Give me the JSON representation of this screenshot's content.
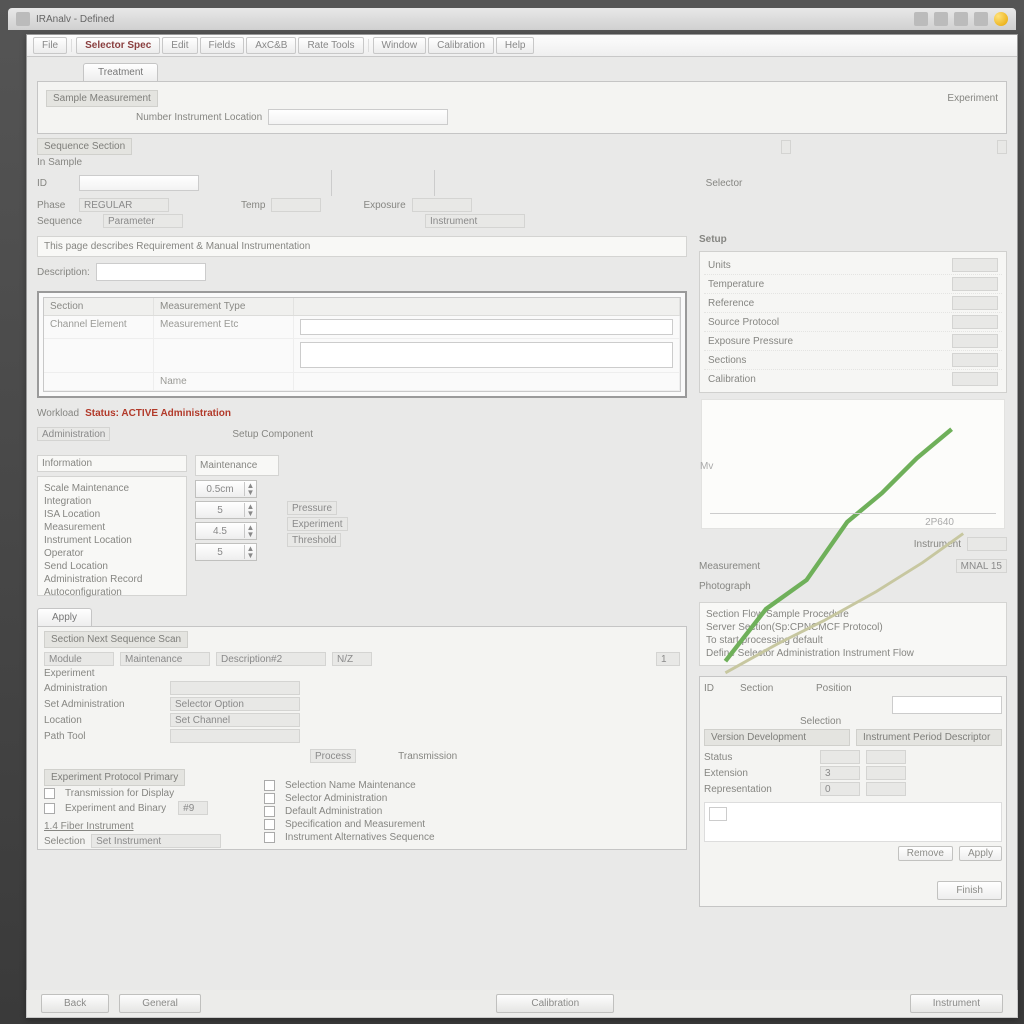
{
  "window": {
    "title": "IRAnalv - Defined"
  },
  "systray": [
    "edit-icon",
    "book-icon",
    "screen-icon",
    "pencil-icon",
    "orb-icon"
  ],
  "toolbar": {
    "buttons": [
      "File",
      "Selector Spec",
      "Edit",
      "Fields",
      "AxC&B",
      "Rate Tools",
      "Window",
      "Calibration",
      "Help"
    ]
  },
  "header": {
    "tab": "Treatment",
    "subtab": "Sample Measurement",
    "side_label": "Experiment",
    "pathrow": {
      "label": "Number Instrument Location",
      "value": ""
    },
    "sectionbar": "Sequence Section",
    "subsection": "In Sample",
    "center_label": "Selector",
    "fields": {
      "id_label": "ID",
      "id_value": "",
      "phase_label": "Phase",
      "phase_value": "REGULAR",
      "temp_label": "Temp",
      "temp_value": "",
      "exposure_label": "Exposure",
      "exposure_value": "",
      "sequence_label": "Sequence",
      "parameter_label": "Parameter",
      "instrument_label": "Instrument"
    }
  },
  "main_panel": {
    "banner": "This page describes Requirement & Manual Instrumentation",
    "search_label": "Description:",
    "grid": {
      "headers": [
        "Section",
        "Measurement Type",
        ""
      ],
      "rows": [
        [
          "Channel Element",
          "Measurement Etc",
          ""
        ],
        [
          "",
          "",
          ""
        ],
        [
          "",
          "Name",
          ""
        ]
      ]
    }
  },
  "alert_line": {
    "prefix": "Workload",
    "text": "Status: ACTIVE Administration"
  },
  "sub_form": {
    "tag": "Administration",
    "link": "Setup Component",
    "group": "Information",
    "sidehead": "Maintenance",
    "items": [
      "Scale Maintenance",
      "Integration",
      "ISA Location",
      "Measurement",
      "Instrument Location",
      "Operator",
      "Send Location",
      "Administration Record",
      "Autoconfiguration"
    ],
    "spins": [
      "0.5cm",
      "5",
      "4.5",
      "5"
    ],
    "right_labels": {
      "a": "Pressure",
      "b": "Experiment",
      "c": "Threshold"
    }
  },
  "right_panel": {
    "title": "Setup",
    "settings": [
      {
        "k": "Units",
        "v": ""
      },
      {
        "k": "Temperature",
        "v": ""
      },
      {
        "k": "Reference",
        "v": ""
      },
      {
        "k": "Source Protocol",
        "v": ""
      },
      {
        "k": "Exposure Pressure",
        "v": ""
      },
      {
        "k": "Sections",
        "v": ""
      },
      {
        "k": "Calibration",
        "v": ""
      }
    ],
    "axis_a": "Mv",
    "axis_b": "2P640",
    "meta_label": "Instrument",
    "panel2_title": "Measurement",
    "panel2_val": "MNAL 15",
    "status_title": "Photograph",
    "status_lines": [
      "Section Flow Sample Procedure",
      "Server Section(Sp:CPNCMCF Protocol)",
      "To start processing default",
      "Define Selector Administration Instrument Flow"
    ],
    "card": {
      "headA": "ID",
      "headB": "Section",
      "headC": "Position",
      "sub": "Selection",
      "tabA": "Version Development",
      "tabB": "Instrument Period Descriptor",
      "rows": [
        {
          "k": "Status",
          "v": ""
        },
        {
          "k": "Extension",
          "v": "3"
        },
        {
          "k": "Representation",
          "v": "0"
        }
      ],
      "btnA": "Remove",
      "btnB": "Apply"
    }
  },
  "lower_left": {
    "tab": "Apply",
    "bar": "Section Next Sequence Scan",
    "cols": [
      "Module",
      "Maintenance",
      "Description#2",
      "N/Z"
    ],
    "value_a": "1",
    "sub": "Experiment",
    "rows": [
      {
        "k": "Administration",
        "v": ""
      },
      {
        "k": "Set Administration",
        "v": "Selector Option"
      },
      {
        "k": "Location",
        "v": "Set Channel"
      },
      {
        "k": "Path Tool",
        "v": ""
      }
    ],
    "note": "Transmission",
    "heading": "Process",
    "groupbar": "Experiment Protocol Primary",
    "chk1": "Transmission for Display",
    "chk2": "Experiment and Binary",
    "chk2_val": "#9",
    "link": "1.4 Fiber Instrument",
    "combo_label": "Selection",
    "combo_value": "Set Instrument",
    "checks": [
      "Selection Name Maintenance",
      "Selector Administration",
      "Default Administration",
      "Specification and Measurement",
      "Instrument Alternatives Sequence"
    ]
  },
  "footer": {
    "left": [
      "Back",
      "General"
    ],
    "center": "Calibration",
    "right": "Instrument",
    "finish": "Finish"
  }
}
